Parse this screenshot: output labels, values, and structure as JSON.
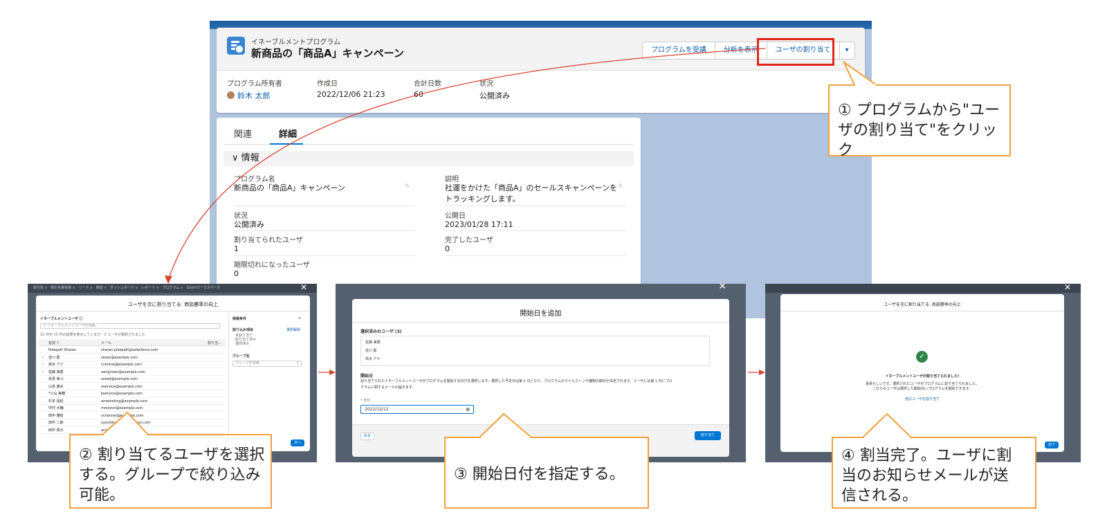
{
  "record": {
    "object_type": "イネーブルメントプログラム",
    "title": "新商品の「商品A」キャンペーン",
    "actions": [
      "プログラムを受講",
      "分析を表示",
      "ユーザの割り当て"
    ],
    "highlights": [
      {
        "label": "プログラム所有者",
        "value": "鈴木 太郎"
      },
      {
        "label": "作成日",
        "value": "2022/12/06 21:23"
      },
      {
        "label": "合計日数",
        "value": "60"
      },
      {
        "label": "状況",
        "value": "公開済み"
      }
    ],
    "tabs": [
      "関連",
      "詳細"
    ],
    "section_title": "情報",
    "fields": {
      "program_name": {
        "label": "プログラム名",
        "value": "新商品の「商品A」キャンペーン"
      },
      "description": {
        "label": "説明",
        "value": "社運をかけた「商品A」のセールスキャンペーンをトラッキングします。"
      },
      "status": {
        "label": "状況",
        "value": "公開済み"
      },
      "publish_date": {
        "label": "公開日",
        "value": "2023/01/28 17:11"
      },
      "assigned_users": {
        "label": "割り当てられたユーザ",
        "value": "1"
      },
      "completed_users": {
        "label": "完了したユーザ",
        "value": "0"
      },
      "expired_users": {
        "label": "期限切れになったユーザ",
        "value": "0"
      }
    }
  },
  "callouts": {
    "c1": "① プログラムから\"ユーザの割り当て\"をクリック",
    "c2": "② 割り当てるユーザを選択する。グループで絞り込み可能。",
    "c3": "③ 開始日付を指定する。",
    "c4": "④ 割当完了。ユーザに割当のお知らせメールが送信される。"
  },
  "step2": {
    "nav": "取引先 ∨　取引先責任者 ∨　リード ∨　商談 ∨　ダッシュボード ∨　レポート ∨　プログラム ∨　Zoomワークスペース",
    "modal_title": "ユーザを次に割り当てる: 商談勝率の向上",
    "list_title": "イネーブルメントユーザ ⓘ",
    "search_placeholder": "イネーブルメントユーザを検索...",
    "list_info": "15 件中 15 件の結果を表示しています・3 ユーザが選択されました",
    "col_name": "名前 ↑",
    "col_email": "メール",
    "col_assigned": "割り当...",
    "rows": [
      {
        "name": "Polepalli Sharan",
        "email": "sharan.polepalli@salesforce.com",
        "checked": false
      },
      {
        "name": "吉川 聡",
        "email": "sexec@example.com",
        "checked": true
      },
      {
        "name": "高木 アナ",
        "email": "ccentral@example.com",
        "checked": true
      },
      {
        "name": "佐藤 美香",
        "email": "aengineer@example.com",
        "checked": true
      },
      {
        "name": "高見 孝三",
        "email": "areed@example.com",
        "checked": false
      },
      {
        "name": "山本 康夫",
        "email": "eservice@example.com",
        "checked": false
      },
      {
        "name": "*小山 美穂",
        "email": "bservice@example.com",
        "checked": false
      },
      {
        "name": "杉本 遥紀",
        "email": "amarketing@example.com",
        "checked": false
      },
      {
        "name": "中村 大輔",
        "email": "mrezzori@example.com",
        "checked": false
      },
      {
        "name": "田中 雅彰",
        "email": "vchannel@example.com",
        "checked": false
      },
      {
        "name": "田中 二郎",
        "email": "yyoshikawa@salesforce.com",
        "checked": false
      },
      {
        "name": "田中 四分",
        "email": "aruiz@example.com",
        "checked": false
      }
    ],
    "filter_title": "検索条件",
    "filter_group_label": "割り込み項目",
    "filter_clear": "選択解除",
    "filter_options": [
      "未割り当て",
      "割り当て済み",
      "選択済み"
    ],
    "group_label": "グループ名",
    "group_placeholder": "グループを検索...",
    "next_button": "次へ"
  },
  "step3": {
    "modal_title": "開始日を追加",
    "selected_label": "選択済みのユーザ (3)",
    "selected_users": [
      "佐藤 美香",
      "吉川 聡",
      "高木 アナ"
    ],
    "start_label": "開始日",
    "help_line1": "割り当てられたイネーブルメントユーザがプログラムを開始する日付を選択します。選択した予定日は第 1 日となり、プログラムのマイルストンや課題の期日が決定されます。ユーザには第 1 日にプロ",
    "help_line2": "グラムに関するメールが届きます。",
    "date_label": "* 日付",
    "date_value": "2022/12/12",
    "back_button": "戻る",
    "assign_button": "割り当て"
  },
  "step4": {
    "modal_title": "ユーザを次に割り当てる: 商談勝率の向上",
    "success_title": "イネーブルメントユーザが割り当てられました!",
    "success_line1": "素晴らしいです。選択されたユーザがプログラムに割り当てられました。",
    "success_line2": "これらのユーザは選択した開始日にプログラムを開始できます。",
    "more_link": "他のユーザを割り当て",
    "done_button": "完了"
  },
  "colors": {
    "accent": "#0176d3",
    "callout_border": "#f0a03c",
    "highlight": "#e2231a",
    "arrow": "#d9432f"
  }
}
